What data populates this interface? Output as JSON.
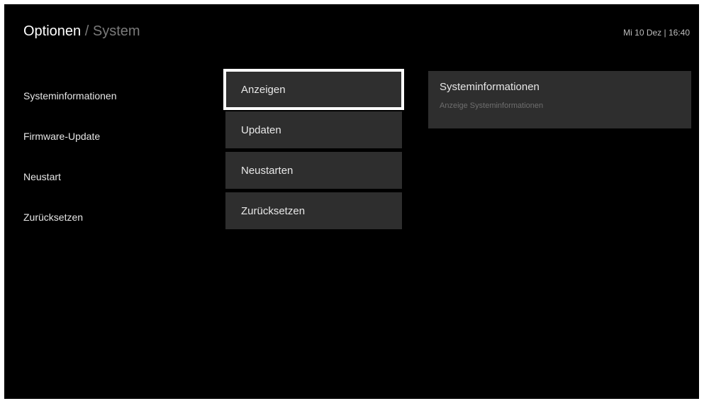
{
  "header": {
    "title_primary": "Optionen",
    "title_separator": "/",
    "title_secondary": "System",
    "clock": "Mi 10 Dez | 16:40"
  },
  "left_menu": {
    "items": [
      {
        "label": "Systeminformationen"
      },
      {
        "label": "Firmware-Update"
      },
      {
        "label": "Neustart"
      },
      {
        "label": "Zurücksetzen"
      }
    ]
  },
  "actions": {
    "items": [
      {
        "label": "Anzeigen",
        "focused": true
      },
      {
        "label": "Updaten",
        "focused": false
      },
      {
        "label": "Neustarten",
        "focused": false
      },
      {
        "label": "Zurücksetzen",
        "focused": false
      }
    ]
  },
  "info_panel": {
    "title": "Systeminformationen",
    "description": "Anzeige Systeminformationen"
  },
  "colors": {
    "background": "#000000",
    "panel": "#2e2e2e",
    "focus_border": "#ffffff",
    "text_primary": "#e8e8e8",
    "text_muted": "#7a7a7a"
  }
}
